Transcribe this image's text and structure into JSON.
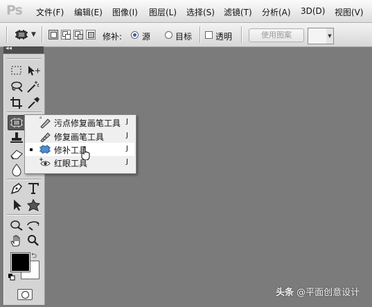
{
  "app": {
    "logo": "Ps"
  },
  "menu": [
    "文件(F)",
    "编辑(E)",
    "图像(I)",
    "图层(L)",
    "选择(S)",
    "滤镜(T)",
    "分析(A)",
    "3D(D)",
    "视图(V)"
  ],
  "options_bar": {
    "tool_icon": "patch-tool-icon",
    "selection_modes": [
      "new-selection-icon",
      "add-to-selection-icon",
      "subtract-from-selection-icon",
      "intersect-selection-icon"
    ],
    "active_mode": 0,
    "patch_label": "修补:",
    "source_label": "源",
    "destination_label": "目标",
    "source_checked": true,
    "transparent_label": "透明",
    "transparent_checked": false,
    "use_pattern_label": "使用图案"
  },
  "toolbox": {
    "collapse_glyph": "◂◂",
    "tools": [
      "rectangular-marquee-icon",
      "move-icon",
      "lasso-icon",
      "magic-wand-icon",
      "crop-icon",
      "eyedropper-icon",
      "patch-tool-icon",
      "clone-stamp-icon",
      "eraser-icon",
      "blur-icon",
      "pen-icon",
      "type-icon",
      "path-selection-icon",
      "custom-shape-icon",
      "3d-rotate-icon",
      "3d-orbit-icon",
      "hand-icon",
      "zoom-icon"
    ],
    "selected_tool": "patch-tool-icon",
    "foreground_color": "#000000",
    "background_color": "#ffffff"
  },
  "flyout": {
    "items": [
      {
        "label": "污点修复画笔工具",
        "shortcut": "J",
        "icon": "spot-healing-brush-icon",
        "active": false
      },
      {
        "label": "修复画笔工具",
        "shortcut": "J",
        "icon": "healing-brush-icon",
        "active": false
      },
      {
        "label": "修补工具",
        "shortcut": "J",
        "icon": "patch-tool-icon",
        "active": true
      },
      {
        "label": "红眼工具",
        "shortcut": "J",
        "icon": "red-eye-icon",
        "active": false
      }
    ]
  },
  "watermark": {
    "logo": "头条",
    "text": "@平面创意设计"
  },
  "colors": {
    "canvas_bg": "#7b7b7b",
    "accent": "#2a64c9"
  }
}
